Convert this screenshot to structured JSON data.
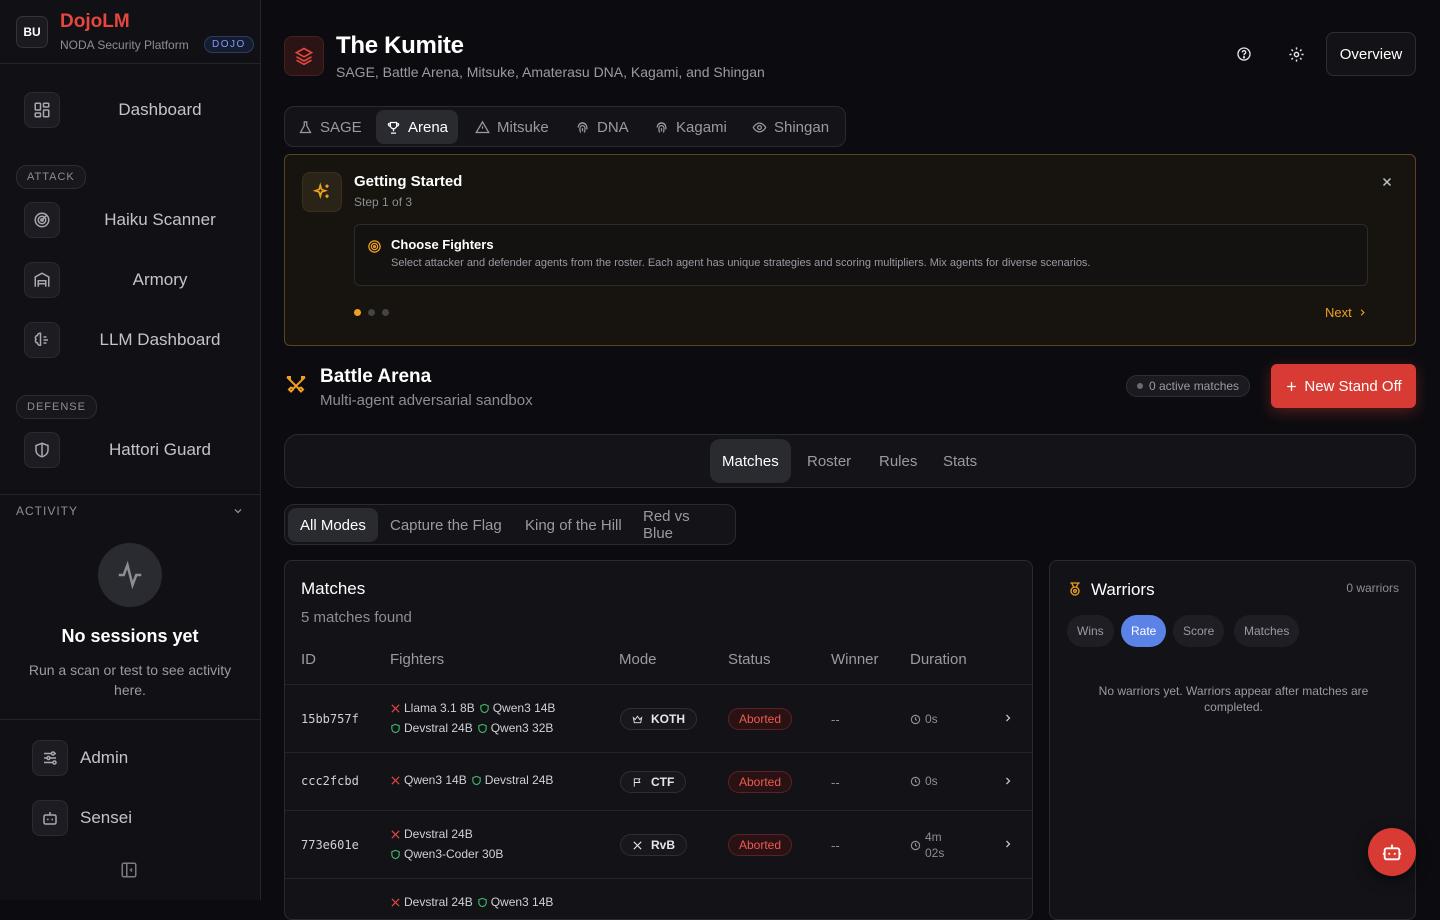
{
  "brand": {
    "initials": "BU",
    "name": "DojoLM",
    "subtitle": "NODA Security Platform",
    "badge": "DOJO"
  },
  "sidebar": {
    "items": [
      {
        "label": "Dashboard",
        "icon": "grid-icon"
      },
      {
        "label": "Haiku Scanner",
        "icon": "radar-icon"
      },
      {
        "label": "Armory",
        "icon": "warehouse-icon"
      },
      {
        "label": "LLM Dashboard",
        "icon": "brain-icon"
      },
      {
        "label": "Hattori Guard",
        "icon": "shield-icon"
      }
    ],
    "sections": {
      "attack": "ATTACK",
      "defense": "DEFENSE"
    },
    "activity": {
      "heading": "ACTIVITY",
      "empty_title": "No sessions yet",
      "empty_sub": "Run a scan or test to see activity here."
    },
    "bottom": [
      {
        "label": "Admin",
        "icon": "sliders-icon"
      },
      {
        "label": "Sensei",
        "icon": "bot-icon"
      }
    ]
  },
  "header": {
    "title": "The Kumite",
    "subtitle": "SAGE, Battle Arena, Mitsuke, Amaterasu DNA, Kagami, and Shingan",
    "overview_label": "Overview"
  },
  "tabs": [
    {
      "label": "SAGE",
      "icon": "flask-icon"
    },
    {
      "label": "Arena",
      "icon": "trophy-icon",
      "active": true
    },
    {
      "label": "Mitsuke",
      "icon": "warning-icon"
    },
    {
      "label": "DNA",
      "icon": "fingerprint-icon"
    },
    {
      "label": "Kagami",
      "icon": "fingerprint-icon"
    },
    {
      "label": "Shingan",
      "icon": "eye-icon"
    }
  ],
  "getting_started": {
    "title": "Getting Started",
    "step": "Step 1 of 3",
    "card_title": "Choose Fighters",
    "card_desc": "Select attacker and defender agents from the roster. Each agent has unique strategies and scoring multipliers. Mix agents for diverse scenarios.",
    "next_label": "Next",
    "current_step": 1,
    "total_steps": 3
  },
  "arena": {
    "title": "Battle Arena",
    "subtitle": "Multi-agent adversarial sandbox",
    "active_matches": "0 active matches",
    "new_button": "New Stand Off",
    "subtabs": [
      "Matches",
      "Roster",
      "Rules",
      "Stats"
    ],
    "modes": [
      "All Modes",
      "Capture the Flag",
      "King of the Hill",
      "Red vs Blue"
    ]
  },
  "matches": {
    "title": "Matches",
    "count_text": "5 matches found",
    "columns": [
      "ID",
      "Fighters",
      "Mode",
      "Status",
      "Winner",
      "Duration"
    ],
    "rows": [
      {
        "id": "15bb757f",
        "fighters": [
          [
            "Llama 3.1 8B",
            "Qwen3 14B"
          ],
          [
            "Devstral 24B",
            "Qwen3 32B"
          ]
        ],
        "mode": "KOTH",
        "status": "Aborted",
        "winner": "--",
        "duration": "0s"
      },
      {
        "id": "ccc2fcbd",
        "fighters": [
          [
            "Qwen3 14B",
            "Devstral 24B"
          ]
        ],
        "mode": "CTF",
        "status": "Aborted",
        "winner": "--",
        "duration": "0s"
      },
      {
        "id": "773e601e",
        "fighters": [
          [
            "Devstral 24B"
          ],
          [
            "Qwen3-Coder 30B"
          ]
        ],
        "mode": "RvB",
        "status": "Aborted",
        "winner": "--",
        "duration": "4m 02s"
      },
      {
        "id": "",
        "fighters": [
          [
            "Devstral 24B",
            "Qwen3 14B"
          ]
        ],
        "mode": "",
        "status": "",
        "winner": "",
        "duration": ""
      }
    ]
  },
  "warriors": {
    "title": "Warriors",
    "count": "0 warriors",
    "tabs": [
      "Wins",
      "Rate",
      "Score",
      "Matches"
    ],
    "active_tab": "Rate",
    "empty": "No warriors yet. Warriors appear after matches are completed."
  },
  "colors": {
    "accent": "#d83b33",
    "brand_red": "#e5473e",
    "amber": "#f0a020",
    "blue": "#5b82e6"
  }
}
